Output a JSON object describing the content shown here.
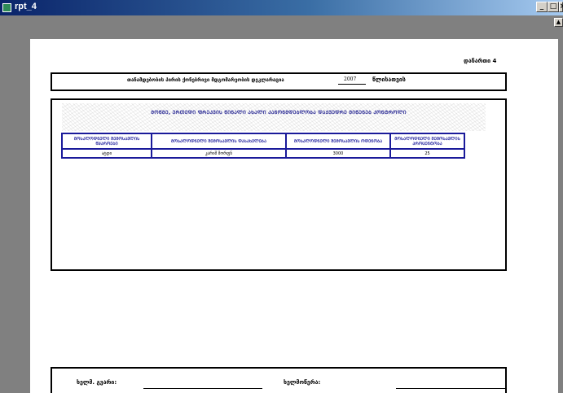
{
  "window": {
    "title": "rpt_4",
    "buttons": {
      "minimize": "_",
      "maximize": "□",
      "close": "×"
    }
  },
  "report": {
    "annex": "დანართი 4",
    "header": {
      "title": "თანამდებობის პირის ქონებრივი მდგომარეობის დეკლარაცია",
      "year": "2007",
      "year_word": "წლისათვის"
    },
    "section_title": "ᲛᲝᲬᲛᲔ, ᲔᲠᲗᲔᲓᲘ ᲤᲠᲔᲙᲕᲘᲡ ᲬᲘᲜᲐᲚᲘ ᲐᲮᲐᲚᲘ ᲙᲐᲜᲝᲜᲛᲓᲔᲑᲚᲝᲑᲐ ᲓᲐᲥᲕᲔᲓᲠᲔ ᲛᲘᲬᲔᲜᲔᲑ ᲙᲝᲜᲢᲠᲝᲚᲘ",
    "table": {
      "headers": [
        "ᲛᲝᲡᲐᲚᲝᲓᲜᲔᲚᲘ ᲨᲔᲛᲝᲡᲐᲕᲚᲘᲡ ᲬᲧᲐᲠᲝᲔᲑᲘ",
        "ᲛᲝᲡᲐᲚᲝᲓᲜᲔᲚᲘ ᲨᲔᲛᲝᲡᲐᲕᲚᲘᲡ ᲓᲐᲡᲐᲮᲔᲚᲔᲑᲐ",
        "ᲛᲝᲡᲐᲚᲝᲓᲜᲔᲚᲘ ᲨᲔᲛᲝᲡᲐᲕᲚᲘᲡ ᲝᲓᲔᲜᲝᲑᲐ",
        "ᲛᲝᲡᲐᲚᲝᲓᲜᲔᲚᲘ ᲨᲔᲛᲝᲡᲐᲕᲚᲘᲡ ᲞᲠᲝᲪᲔᲜᲢᲝᲑᲐ"
      ],
      "rows": [
        [
          "ატდი",
          "კარიშ შორფნ",
          "3000",
          "25"
        ]
      ]
    },
    "footer": {
      "label1": "ხელმ. გვარი:",
      "label2": "ხელმოწერა:"
    }
  }
}
